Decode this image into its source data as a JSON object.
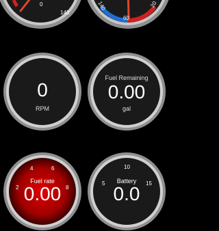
{
  "gauges": {
    "speed": {
      "tick_0": "0",
      "tick_140": "140"
    },
    "temp": {
      "tick_140": "140",
      "tick_60": "60",
      "tick_20": "20"
    },
    "rpm": {
      "value": "0",
      "label": "RPM"
    },
    "fuel_remaining": {
      "title": "Fuel Remaining",
      "value": "0.00",
      "unit": "gal"
    },
    "fuel_rate": {
      "title": "Fuel rate",
      "value": "0.00",
      "ticks": [
        "2",
        "4",
        "6",
        "8"
      ]
    },
    "battery": {
      "title": "Battery",
      "value": "0.0",
      "ticks": [
        "5",
        "10",
        "15"
      ]
    }
  },
  "colors": {
    "bezel": "#9a9a9a",
    "face": "#1c1c1c",
    "red_face": "#b00000",
    "needle": "#e0462a",
    "arc_blue": "#1f6fd1",
    "arc_red": "#d02020"
  }
}
